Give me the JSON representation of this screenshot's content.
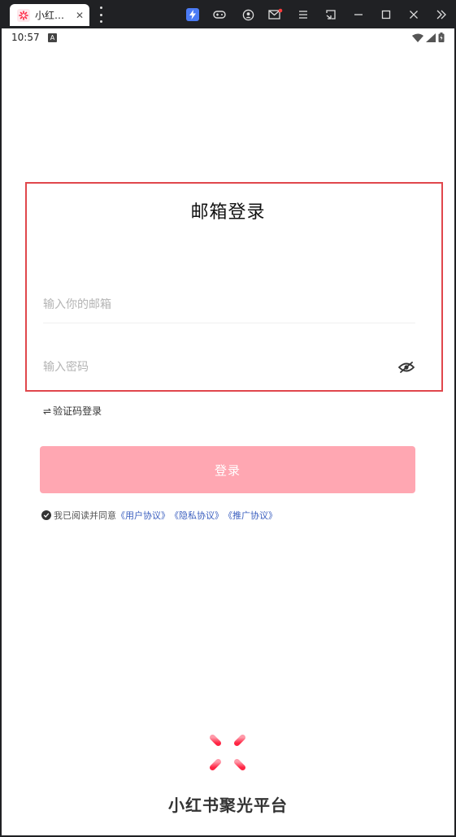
{
  "window": {
    "tab_title": "小红…",
    "tab_close": "✕",
    "toolbar_icons": [
      "bolt-icon",
      "gamepad-icon",
      "account-icon",
      "mail-icon",
      "menu-icon",
      "resize-icon",
      "minimize-icon",
      "maximize-icon",
      "close-icon",
      "expand-icon"
    ]
  },
  "status_bar": {
    "time": "10:57",
    "notification_badge": "A"
  },
  "login": {
    "title": "邮箱登录",
    "email_placeholder": "输入你的邮箱",
    "password_placeholder": "输入密码",
    "switch_label": "验证码登录",
    "switch_icon": "⇌",
    "submit_label": "登录",
    "agreement_prefix": "我已阅读并同意",
    "agreement_links": [
      "《用户协议》",
      "《隐私协议》",
      "《推广协议》"
    ]
  },
  "brand": {
    "name": "小红书聚光平台"
  },
  "colors": {
    "accent": "#ff2442",
    "button_disabled": "#ffa7b2",
    "highlight": "#e0474c",
    "link": "#3b5fbf"
  }
}
